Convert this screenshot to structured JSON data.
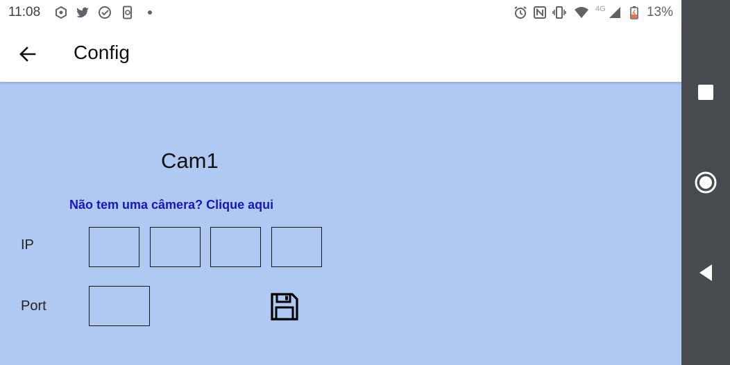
{
  "status_bar": {
    "time": "11:08",
    "battery_percent": "13%",
    "network": "4G",
    "icons_left": [
      "hexagon-notification-icon",
      "twitter-icon",
      "check-circle-icon",
      "phone-sync-icon",
      "dot-icon"
    ],
    "icons_right": [
      "alarm-icon",
      "nfc-icon",
      "vibrate-icon",
      "wifi-icon",
      "signal-icon",
      "battery-icon"
    ]
  },
  "app_bar": {
    "title": "Config",
    "back_icon": "arrow-back-icon"
  },
  "main": {
    "camera_name": "Cam1",
    "no_camera_link": "Não tem uma câmera? Clique aqui",
    "ip_label": "IP",
    "ip_fields": [
      "",
      "",
      "",
      ""
    ],
    "port_label": "Port",
    "port_value": "",
    "save_icon": "floppy-disk-icon"
  },
  "nav_bar": {
    "buttons": [
      "recents-square-icon",
      "home-circle-icon",
      "back-triangle-icon"
    ]
  },
  "colors": {
    "content_background": "#b0c9f3",
    "link": "#1a16b8",
    "nav_bar": "#474a4f"
  }
}
